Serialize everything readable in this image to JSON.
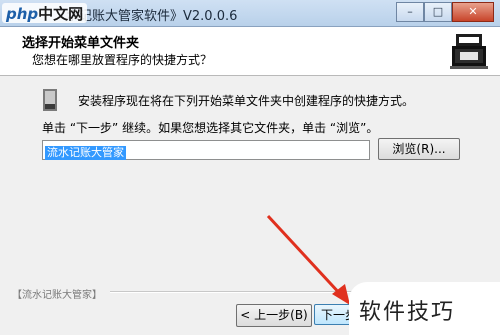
{
  "window": {
    "title": "水记账大管家软件》V2.0.0.6",
    "controls": {
      "minimize": "–",
      "maximize": "□",
      "close": "✕"
    }
  },
  "overlay_watermark_top": {
    "brand_prefix": "php",
    "brand_text": "中文网"
  },
  "header": {
    "title": "选择开始菜单文件夹",
    "subtitle": "您想在哪里放置程序的快捷方式？",
    "icon": "computer-install-icon"
  },
  "body": {
    "intro": "安装程序现在将在下列开始菜单文件夹中创建程序的快捷方式。",
    "instruction": "单击 “下一步” 继续。如果您想选择其它文件夹，单击 “浏览”。",
    "folder_value": "流水记账大管家",
    "browse_label": "浏览(R)..."
  },
  "footer": {
    "group_label": "【流水记账大管家】",
    "back_label": "< 上一步(B)",
    "next_label": "下一步"
  },
  "overlay_watermark_bottom": {
    "text": "软件技巧"
  },
  "colors": {
    "annotation_arrow": "#e0301e",
    "selection": "#3399ff"
  }
}
